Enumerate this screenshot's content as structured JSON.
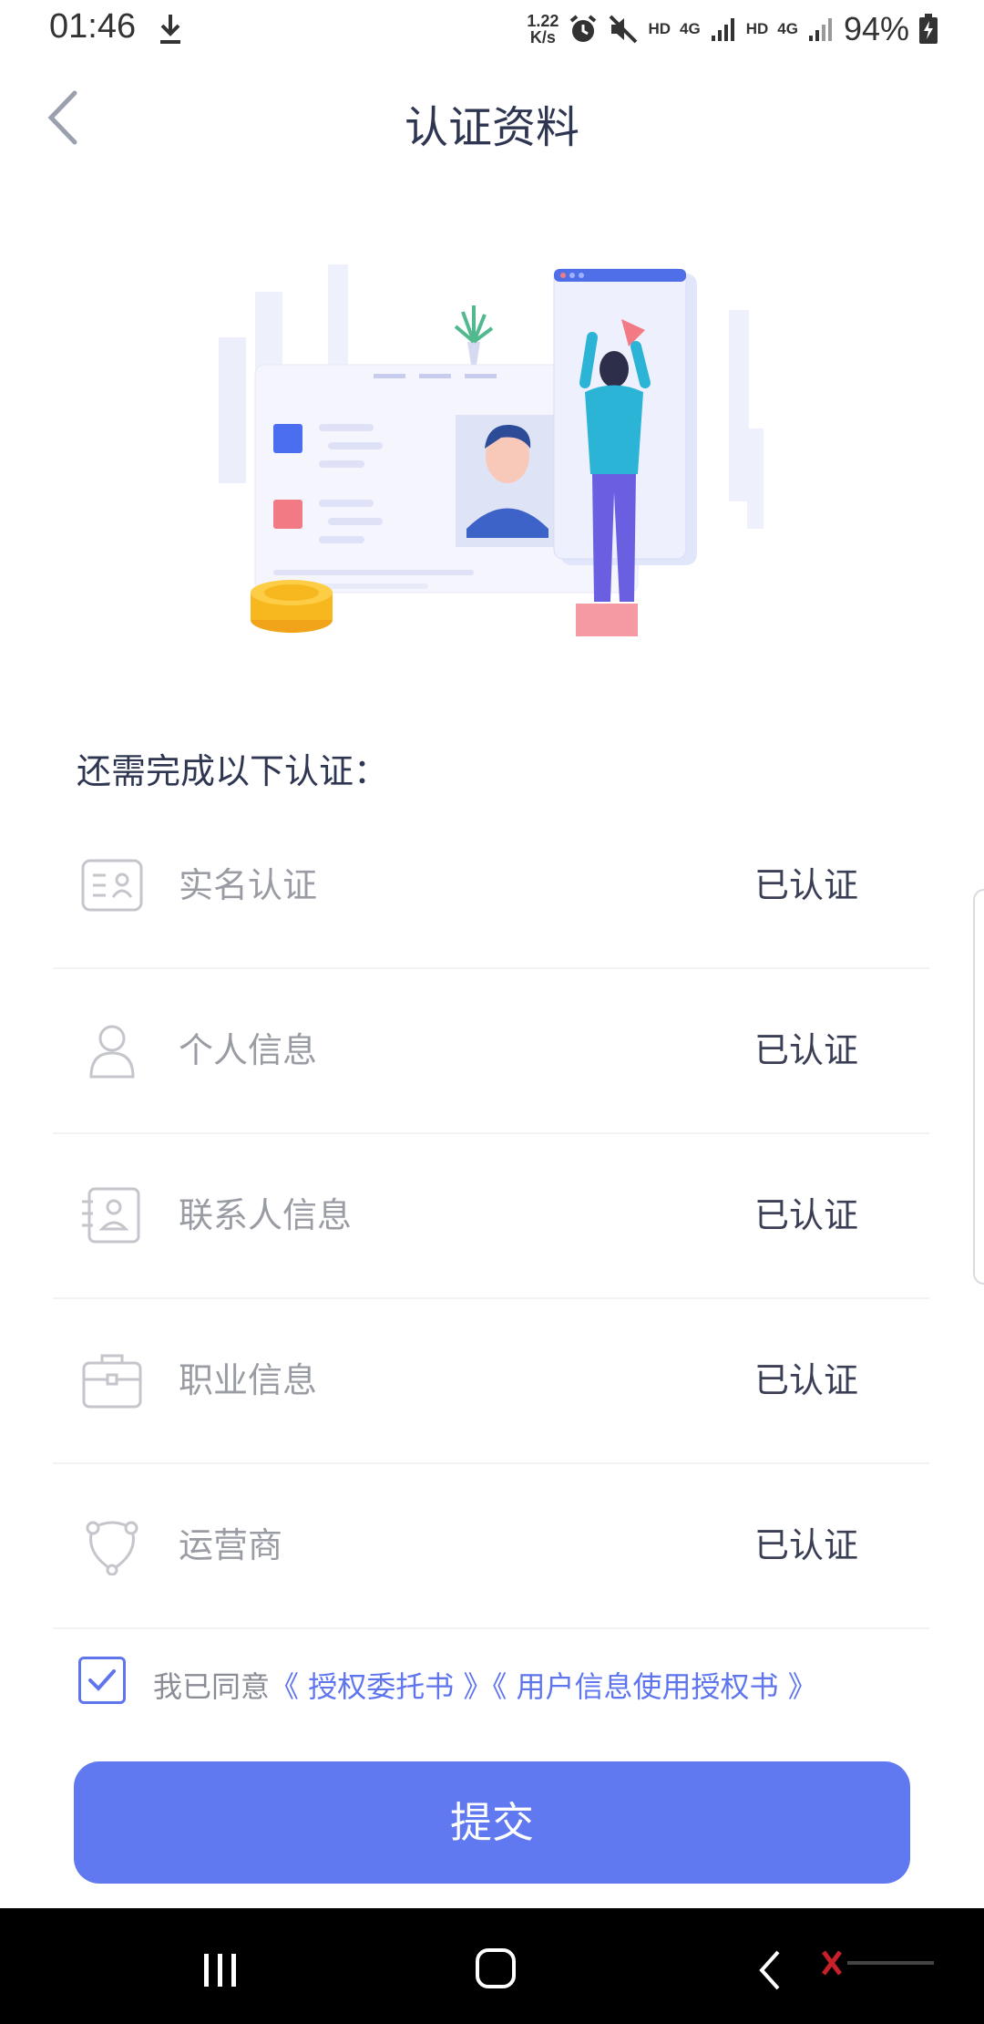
{
  "status_bar": {
    "time": "01:46",
    "net_speed_value": "1.22",
    "net_speed_unit": "K/s",
    "hd1": "HD",
    "net1": "4G",
    "hd2": "HD",
    "net2": "4G",
    "battery": "94%",
    "icons": [
      "download-icon",
      "alarm-icon",
      "mute-icon",
      "signal-icon",
      "battery-charging-icon"
    ]
  },
  "header": {
    "title": "认证资料",
    "back_icon": "chevron-left-icon"
  },
  "section_title": "还需完成以下认证：",
  "cert_items": [
    {
      "label": "实名认证",
      "status": "已认证",
      "icon": "id-card-icon"
    },
    {
      "label": "个人信息",
      "status": "已认证",
      "icon": "person-icon"
    },
    {
      "label": "联系人信息",
      "status": "已认证",
      "icon": "contact-card-icon"
    },
    {
      "label": "职业信息",
      "status": "已认证",
      "icon": "briefcase-icon"
    },
    {
      "label": "运营商",
      "status": "已认证",
      "icon": "carrier-icon"
    }
  ],
  "agreement": {
    "checked": true,
    "prefix": "我已同意",
    "link1": "《 授权委托书 》",
    "link2": "《 用户信息使用授权书 》"
  },
  "submit_label": "提交",
  "colors": {
    "accent": "#6078f0",
    "title": "#2f3652",
    "muted": "#9a9ca3"
  }
}
